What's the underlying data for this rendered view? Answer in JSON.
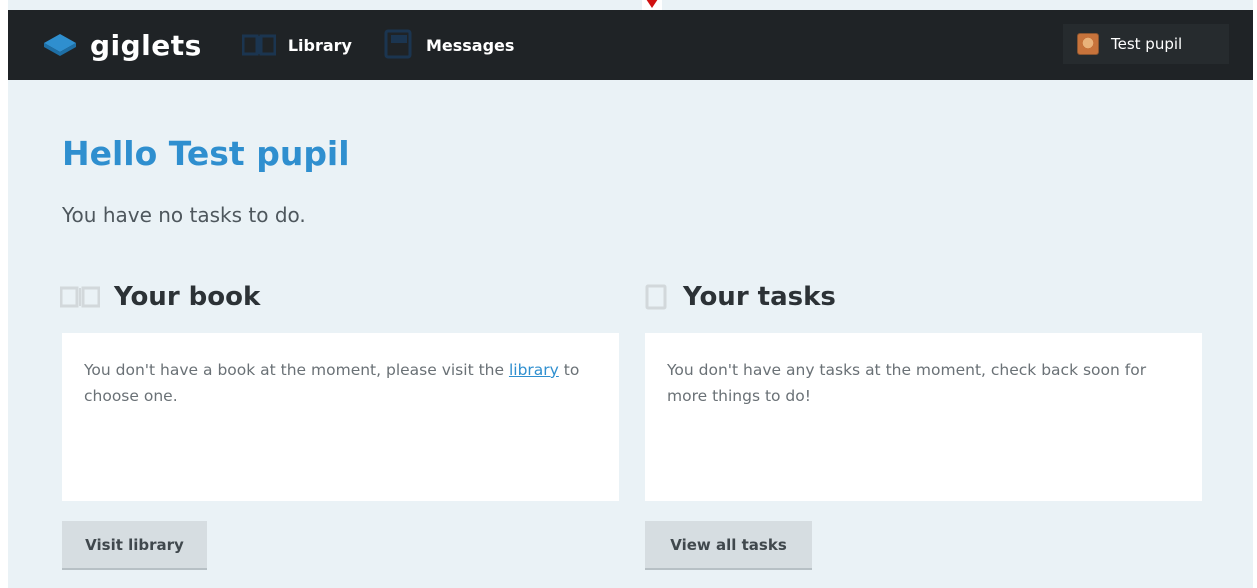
{
  "navbar": {
    "brand": "giglets",
    "items": [
      {
        "label": "Library",
        "icon": "book-open-icon"
      },
      {
        "label": "Messages",
        "icon": "message-icon"
      }
    ],
    "user": {
      "name": "Test pupil",
      "icon": "avatar"
    }
  },
  "main": {
    "greeting": "Hello Test pupil",
    "subtext": "You have no tasks to do.",
    "book": {
      "title": "Your book",
      "text_before": "You don't have a book at the moment, please visit the",
      "link": "library",
      "text_after": "to choose one.",
      "button": "Visit library"
    },
    "tasks": {
      "title": "Your tasks",
      "text": "You don't have any tasks at the moment, check back soon for more things to do!",
      "button": "View all tasks"
    }
  },
  "colors": {
    "navbar_bg": "#1f2326",
    "page_bg": "#eaf2f6",
    "accent": "#2f8fcf",
    "button_bg": "#d6dde1"
  }
}
